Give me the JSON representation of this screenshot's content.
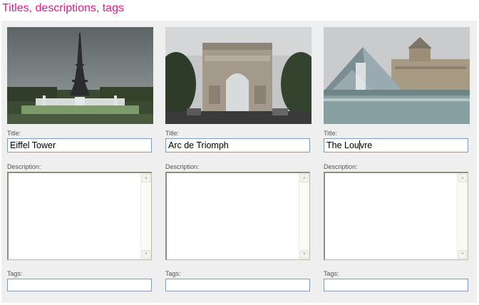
{
  "header": {
    "title": "Titles, descriptions, tags"
  },
  "labels": {
    "title": "Title:",
    "description": "Description:",
    "tags": "Tags:"
  },
  "scroll_icons": {
    "up": "▲",
    "down": "▼"
  },
  "cards": [
    {
      "title_value": "Eiffel Tower",
      "description_value": "",
      "tags_value": "",
      "photo": "eiffel-tower-photo"
    },
    {
      "title_value": "Arc de Triomph",
      "description_value": "",
      "tags_value": "",
      "photo": "arc-de-triomphe-photo"
    },
    {
      "title_value_before_caret": "The Lou",
      "title_value_after_caret": "vre",
      "description_value": "",
      "tags_value": "",
      "photo": "louvre-photo"
    }
  ],
  "colors": {
    "title_accent": "#e6198c",
    "panel_bg": "#efefef",
    "field_border": "#7f9db9"
  }
}
